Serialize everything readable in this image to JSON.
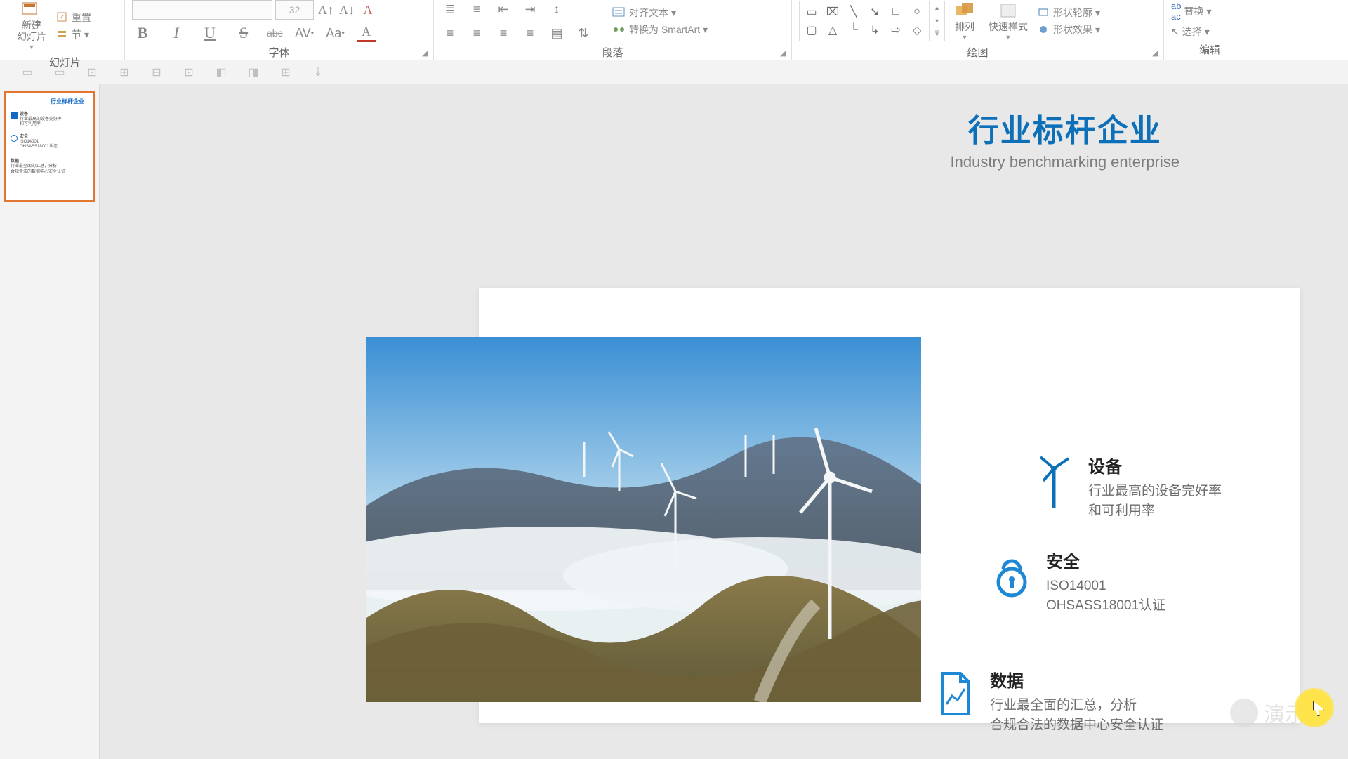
{
  "ribbon": {
    "new_slide": "新建\n幻灯片",
    "reset": "重置",
    "section": "节",
    "slides_label": "幻灯片",
    "font_size": "32",
    "font_label": "字体",
    "para_label": "段落",
    "align_text": "对齐文本",
    "smartart": "转换为 SmartArt",
    "draw_label": "绘图",
    "arrange": "排列",
    "quick_style": "快速样式",
    "shape_outline": "形状轮廓",
    "shape_effects": "形状效果",
    "replace": "替换",
    "select": "选择",
    "edit_label": "编辑"
  },
  "slide": {
    "title": "行业标杆企业",
    "subtitle": "Industry benchmarking enterprise",
    "f1_title": "设备",
    "f1_l1": "行业最高的设备完好率",
    "f1_l2": "和可利用率",
    "f2_title": "安全",
    "f2_l1": "ISO14001",
    "f2_l2": "OHSASS18001认证",
    "f3_title": "数据",
    "f3_l1": "行业最全面的汇总，分析",
    "f3_l2": "合规合法的数据中心安全认证"
  },
  "watermark": "演示"
}
